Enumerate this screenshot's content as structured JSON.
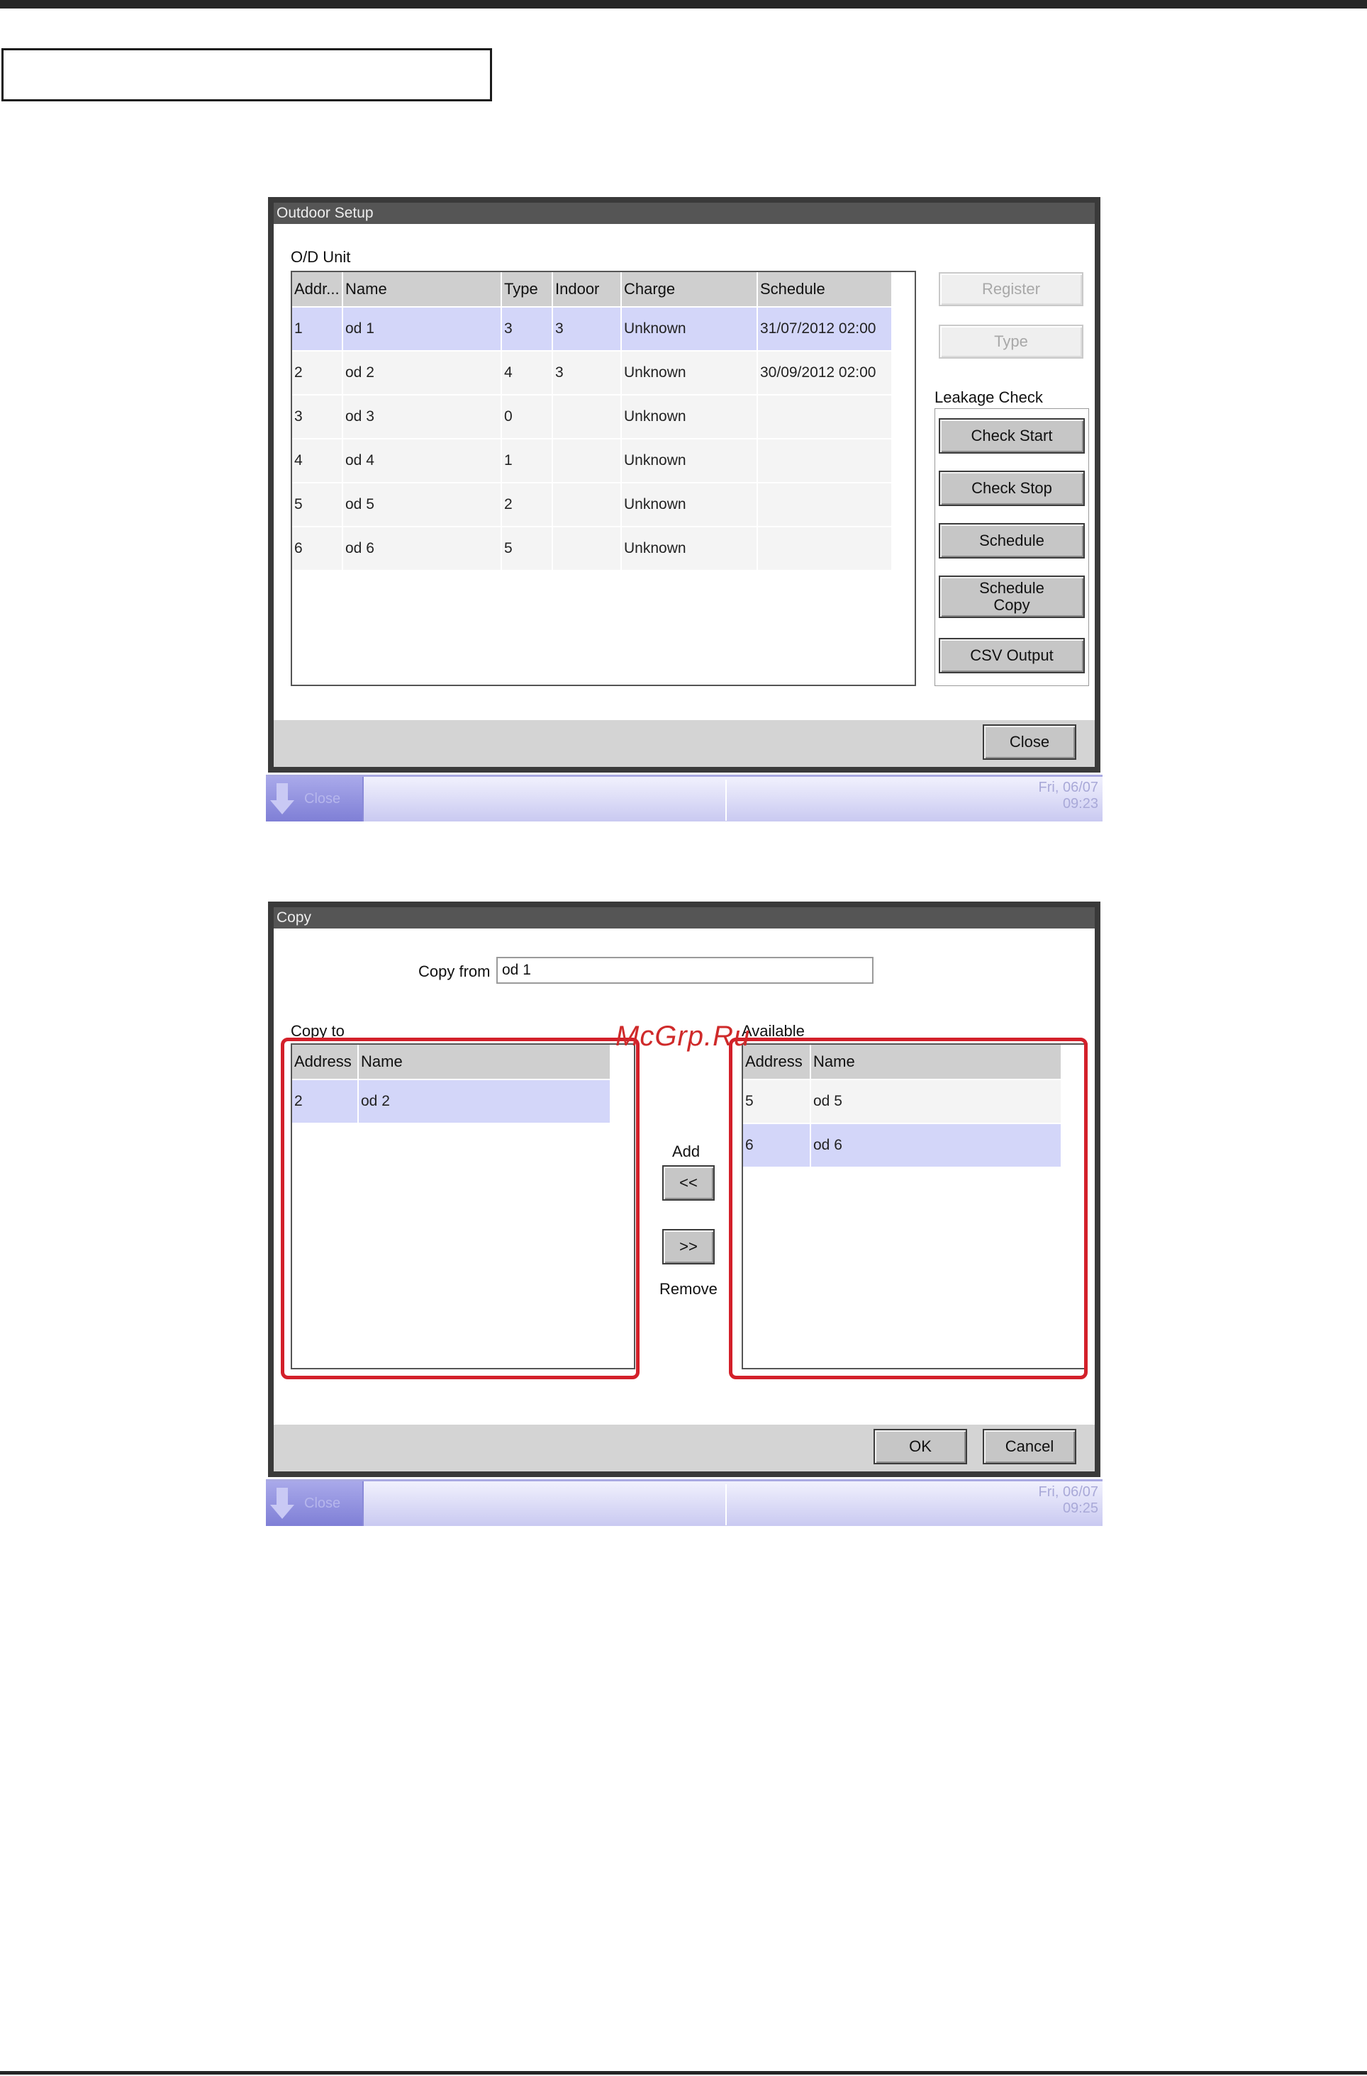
{
  "window1": {
    "title": "Outdoor Setup",
    "section_label": "O/D Unit",
    "columns": [
      "Addr...",
      "Name",
      "Type",
      "Indoor",
      "Charge",
      "Schedule"
    ],
    "rows": [
      {
        "addr": "1",
        "name": "od 1",
        "type": "3",
        "indoor": "3",
        "charge": "Unknown",
        "schedule": "31/07/2012 02:00",
        "selected": true
      },
      {
        "addr": "2",
        "name": "od 2",
        "type": "4",
        "indoor": "3",
        "charge": "Unknown",
        "schedule": "30/09/2012 02:00",
        "selected": false
      },
      {
        "addr": "3",
        "name": "od 3",
        "type": "0",
        "indoor": "",
        "charge": "Unknown",
        "schedule": "",
        "selected": false
      },
      {
        "addr": "4",
        "name": "od 4",
        "type": "1",
        "indoor": "",
        "charge": "Unknown",
        "schedule": "",
        "selected": false
      },
      {
        "addr": "5",
        "name": "od 5",
        "type": "2",
        "indoor": "",
        "charge": "Unknown",
        "schedule": "",
        "selected": false
      },
      {
        "addr": "6",
        "name": "od 6",
        "type": "5",
        "indoor": "",
        "charge": "Unknown",
        "schedule": "",
        "selected": false
      }
    ],
    "register_label": "Register",
    "type_label": "Type",
    "leakage_label": "Leakage Check",
    "check_start_label": "Check Start",
    "check_stop_label": "Check Stop",
    "schedule_label": "Schedule",
    "schedule_copy_label": "Schedule Copy",
    "csv_label": "CSV Output",
    "close_label": "Close"
  },
  "statusbar1": {
    "button_label": "Close",
    "date": "Fri, 06/07",
    "time": "09:23"
  },
  "window2": {
    "title": "Copy",
    "copy_from_label": "Copy from",
    "copy_from_value": "od 1",
    "copy_to_label": "Copy to",
    "available_label": "Available",
    "columns": [
      "Address",
      "Name"
    ],
    "copy_to_rows": [
      {
        "addr": "2",
        "name": "od 2",
        "selected": true
      }
    ],
    "available_rows": [
      {
        "addr": "5",
        "name": "od 5",
        "selected": false
      },
      {
        "addr": "6",
        "name": "od 6",
        "selected": true
      }
    ],
    "add_label": "Add",
    "add_button": "<<",
    "remove_button": ">>",
    "remove_label": "Remove",
    "ok_label": "OK",
    "cancel_label": "Cancel"
  },
  "statusbar2": {
    "button_label": "Close",
    "date": "Fri, 06/07",
    "time": "09:25"
  },
  "watermark": "McGrp.Ru",
  "colors": {
    "selected_row": "#d3d6f9",
    "highlight_border": "#d3202a",
    "statusbar": "#c9c9f1"
  }
}
